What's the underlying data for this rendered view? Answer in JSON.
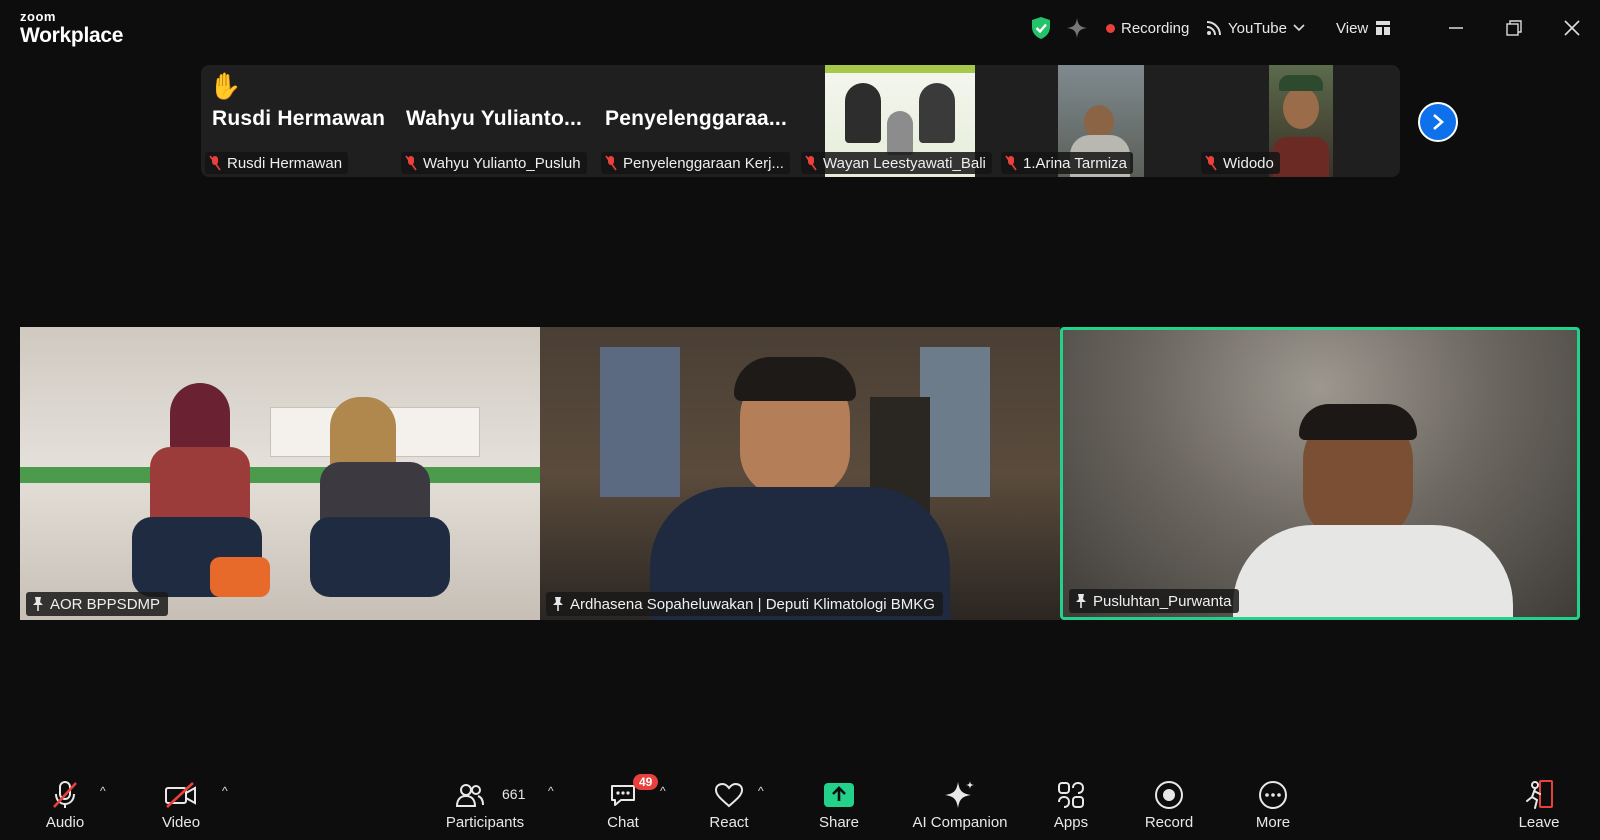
{
  "app": {
    "brand_small": "zoom",
    "brand_large": "Workplace"
  },
  "titlebar": {
    "recording_label": "Recording",
    "stream_label": "YouTube",
    "view_label": "View",
    "icons": [
      "shield-check-icon",
      "sparkle-icon",
      "record-dot-icon",
      "stream-icon",
      "chevron-down-icon",
      "grid-icon",
      "minimize-icon",
      "restore-icon",
      "close-icon"
    ]
  },
  "strip": {
    "tiles": [
      {
        "big_name": "Rusdi Hermawan",
        "label": "Rusdi Hermawan",
        "raised_hand": true
      },
      {
        "big_name": "Wahyu  Yulianto...",
        "label": "Wahyu Yulianto_Pusluh"
      },
      {
        "big_name": "Penyelenggaraa...",
        "label": "Penyelenggaraan Kerj..."
      },
      {
        "label": "Wayan Leestyawati_Bali"
      },
      {
        "label": "1.Arina Tarmiza"
      },
      {
        "label": "Widodo"
      }
    ]
  },
  "main": {
    "tiles": [
      {
        "name": "AOR BPPSDMP"
      },
      {
        "name": "Ardhasena Sopaheluwakan | Deputi Klimatologi BMKG"
      },
      {
        "name": "Pusluhtan_Purwanta",
        "active_speaker": true
      }
    ]
  },
  "toolbar": {
    "audio": "Audio",
    "video": "Video",
    "participants": "Participants",
    "participant_count": "661",
    "chat": "Chat",
    "chat_badge": "49",
    "react": "React",
    "share": "Share",
    "ai_companion": "AI Companion",
    "apps": "Apps",
    "record": "Record",
    "more": "More",
    "leave": "Leave"
  },
  "colors": {
    "accent_blue": "#0e71eb",
    "active_green": "#23d18b",
    "share_green": "#23d18b",
    "danger_red": "#e8403c"
  }
}
